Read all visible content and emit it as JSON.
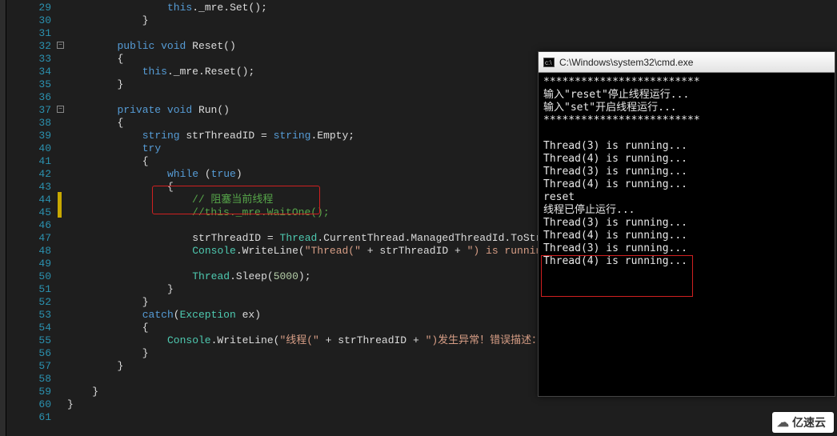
{
  "lines": [
    {
      "n": 29,
      "t": "                this._mre.Set();"
    },
    {
      "n": 30,
      "t": "            }"
    },
    {
      "n": 31,
      "t": ""
    },
    {
      "n": 32,
      "t": "        public void Reset()",
      "fold": true
    },
    {
      "n": 33,
      "t": "        {"
    },
    {
      "n": 34,
      "t": "            this._mre.Reset();"
    },
    {
      "n": 35,
      "t": "        }"
    },
    {
      "n": 36,
      "t": ""
    },
    {
      "n": 37,
      "t": "        private void Run()",
      "fold": true
    },
    {
      "n": 38,
      "t": "        {"
    },
    {
      "n": 39,
      "t": "            string strThreadID = string.Empty;"
    },
    {
      "n": 40,
      "t": "            try"
    },
    {
      "n": 41,
      "t": "            {"
    },
    {
      "n": 42,
      "t": "                while (true)"
    },
    {
      "n": 43,
      "t": "                {"
    },
    {
      "n": 44,
      "t": "                    // 阻塞当前线程",
      "mark": "y"
    },
    {
      "n": 45,
      "t": "                    //this._mre.WaitOne();",
      "mark": "y"
    },
    {
      "n": 46,
      "t": ""
    },
    {
      "n": 47,
      "t": "                    strThreadID = Thread.CurrentThread.ManagedThreadId.ToString();"
    },
    {
      "n": 48,
      "t": "                    Console.WriteLine(\"Thread(\" + strThreadID + \") is running...\");"
    },
    {
      "n": 49,
      "t": ""
    },
    {
      "n": 50,
      "t": "                    Thread.Sleep(5000);"
    },
    {
      "n": 51,
      "t": "                }"
    },
    {
      "n": 52,
      "t": "            }"
    },
    {
      "n": 53,
      "t": "            catch(Exception ex)"
    },
    {
      "n": 54,
      "t": "            {"
    },
    {
      "n": 55,
      "t": "                Console.WriteLine(\"线程(\" + strThreadID + \")发生异常！错误描述：\" + "
    },
    {
      "n": 56,
      "t": "            }"
    },
    {
      "n": 57,
      "t": "        }"
    },
    {
      "n": 58,
      "t": ""
    },
    {
      "n": 59,
      "t": "    }"
    },
    {
      "n": 60,
      "t": "}"
    },
    {
      "n": 61,
      "t": ""
    }
  ],
  "console": {
    "title": "C:\\Windows\\system32\\cmd.exe",
    "lines": [
      "*************************",
      "输入\"reset\"停止线程运行...",
      "输入\"set\"开启线程运行...",
      "*************************",
      "",
      "Thread(3) is running...",
      "Thread(4) is running...",
      "Thread(3) is running...",
      "Thread(4) is running...",
      "reset",
      "线程已停止运行...",
      "Thread(3) is running...",
      "Thread(4) is running...",
      "Thread(3) is running...",
      "Thread(4) is running..."
    ]
  },
  "watermark": "亿速云"
}
